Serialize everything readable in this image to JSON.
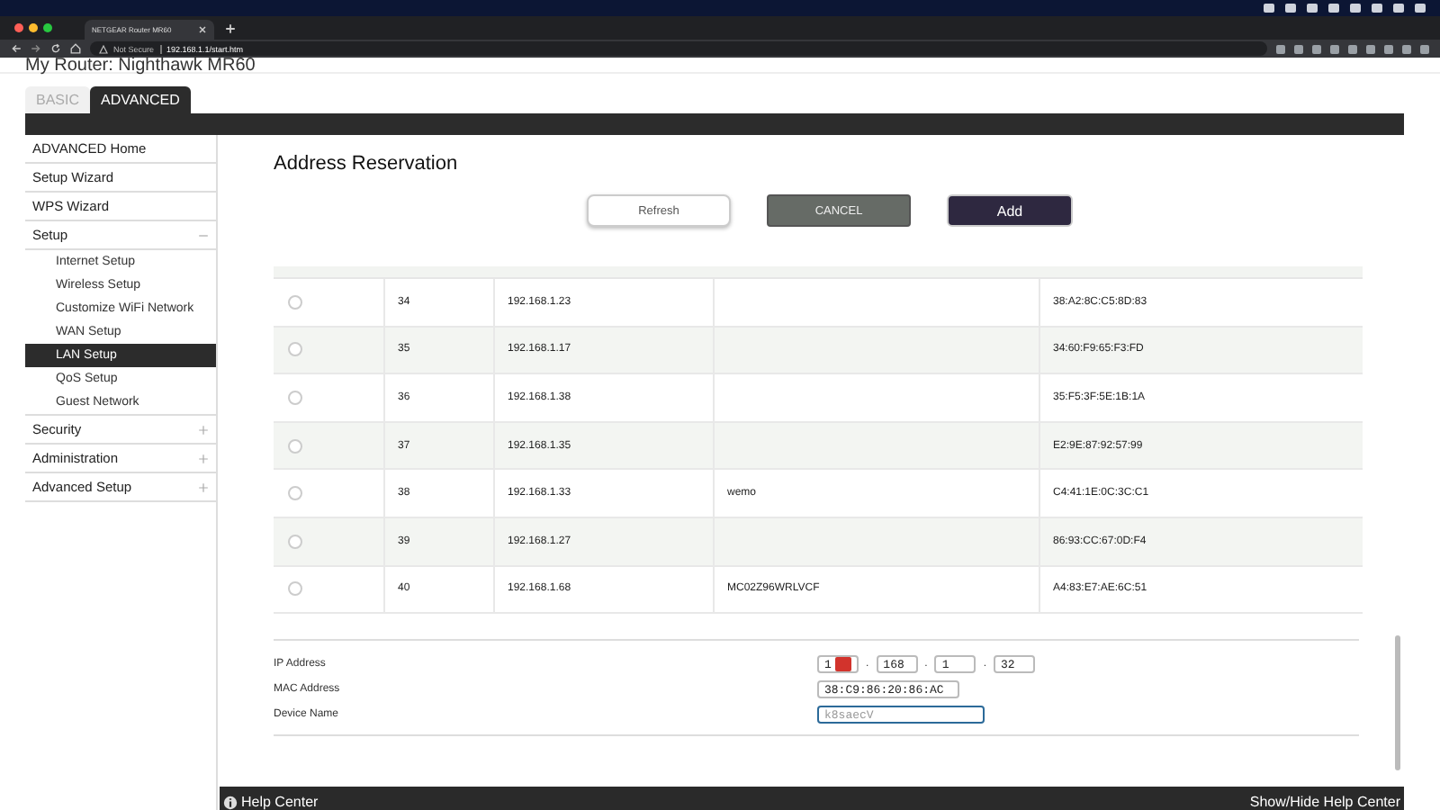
{
  "browser": {
    "tab_title": "NETGEAR Router MR60",
    "security": "Not Secure",
    "url": "192.168.1.1/start.htm"
  },
  "router_title": "My Router: Nighthawk MR60",
  "tabs": [
    {
      "label": "BASIC",
      "selected": false
    },
    {
      "label": "ADVANCED",
      "selected": true
    }
  ],
  "sidebar": {
    "items": [
      {
        "label": "ADVANCED Home",
        "kind": "link"
      },
      {
        "label": "Setup Wizard",
        "kind": "link"
      },
      {
        "label": "WPS Wizard",
        "kind": "link"
      },
      {
        "label": "Setup",
        "kind": "group",
        "expanded": true,
        "children": [
          {
            "label": "Internet Setup",
            "selected": false
          },
          {
            "label": "Wireless Setup",
            "selected": false
          },
          {
            "label": "Customize WiFi Network",
            "selected": false
          },
          {
            "label": "WAN Setup",
            "selected": false
          },
          {
            "label": "LAN Setup",
            "selected": true
          },
          {
            "label": "QoS Setup",
            "selected": false
          },
          {
            "label": "Guest Network",
            "selected": false
          }
        ]
      },
      {
        "label": "Security",
        "kind": "group",
        "expanded": false
      },
      {
        "label": "Administration",
        "kind": "group",
        "expanded": false
      },
      {
        "label": "Advanced Setup",
        "kind": "group",
        "expanded": false
      }
    ]
  },
  "page_title": "Address Reservation",
  "buttons": [
    {
      "label": "Refresh",
      "kind": "light"
    },
    {
      "label": "CANCEL",
      "kind": "grey"
    },
    {
      "label": "Add",
      "kind": "dark"
    }
  ],
  "table": {
    "rows": [
      {
        "selected": false,
        "number": "34",
        "ip": "192.168.1.23",
        "name": "",
        "mac": "38:A2:8C:C5:8D:83"
      },
      {
        "selected": false,
        "number": "35",
        "ip": "192.168.1.17",
        "name": "",
        "mac": "34:60:F9:65:F3:FD"
      },
      {
        "selected": false,
        "number": "36",
        "ip": "192.168.1.38",
        "name": "",
        "mac": "35:F5:3F:5E:1B:1A"
      },
      {
        "selected": false,
        "number": "37",
        "ip": "192.168.1.35",
        "name": "",
        "mac": "E2:9E:87:92:57:99"
      },
      {
        "selected": false,
        "number": "38",
        "ip": "192.168.1.33",
        "name": "wemo",
        "mac": "C4:41:1E:0C:3C:C1"
      },
      {
        "selected": false,
        "number": "39",
        "ip": "192.168.1.27",
        "name": "",
        "mac": "86:93:CC:67:0D:F4"
      },
      {
        "selected": false,
        "number": "40",
        "ip": "192.168.1.68",
        "name": "MC02Z96WRLVCF",
        "mac": "A4:83:E7:AE:6C:51"
      }
    ]
  },
  "form": {
    "ip_label": "IP Address",
    "ip_octets": [
      "1",
      "168",
      "1",
      "32"
    ],
    "ip_separator": ".",
    "mac_label": "MAC Address",
    "mac_value": "38:C9:86:20:86:AC",
    "device_label": "Device Name",
    "device_placeholder": "k8saecV"
  },
  "help": {
    "title": "Help Center",
    "toggle": "Show/Hide Help Center"
  }
}
